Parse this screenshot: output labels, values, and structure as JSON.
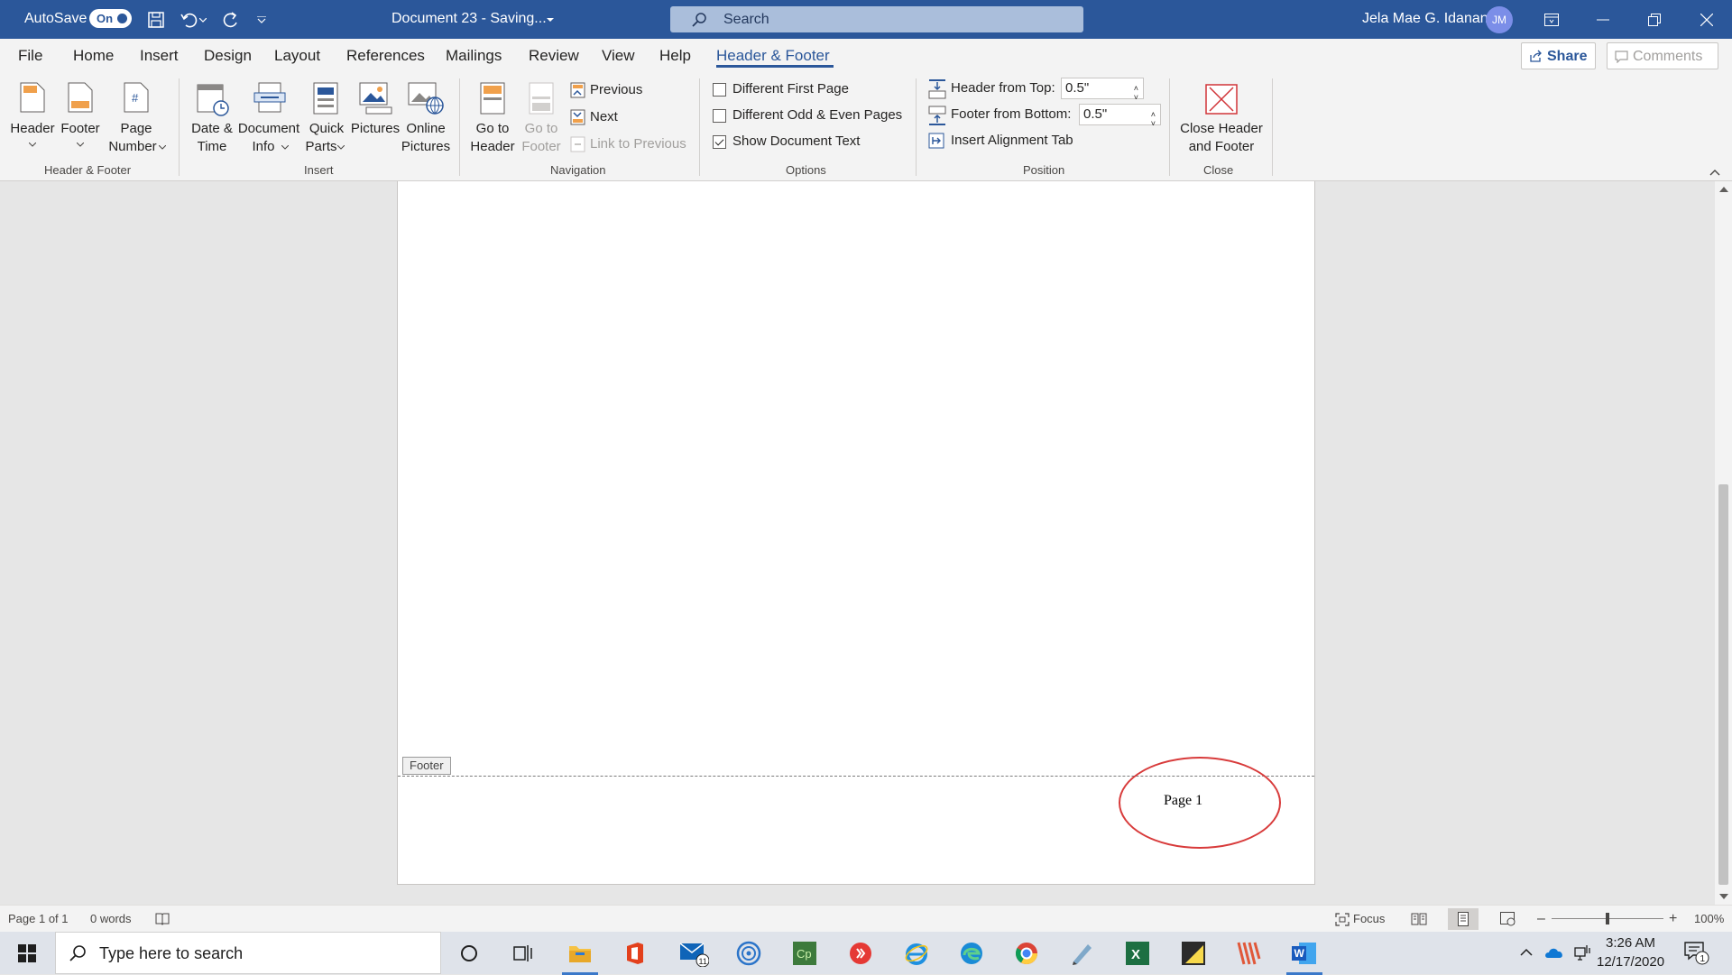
{
  "titlebar": {
    "autosave_label": "AutoSave",
    "autosave_state": "On",
    "document_title": "Document 23  -  Saving...",
    "search_placeholder": "Search",
    "user_name": "Jela Mae G. Idanan",
    "user_initials": "JM"
  },
  "tabs": [
    "File",
    "Home",
    "Insert",
    "Design",
    "Layout",
    "References",
    "Mailings",
    "Review",
    "View",
    "Help",
    "Header & Footer"
  ],
  "active_tab": "Header & Footer",
  "share_label": "Share",
  "comments_label": "Comments",
  "ribbon": {
    "groups": [
      "Header & Footer",
      "Insert",
      "Navigation",
      "Options",
      "Position",
      "Close"
    ],
    "header_footer": {
      "header": "Header",
      "footer": "Footer",
      "page_number_1": "Page",
      "page_number_2": "Number"
    },
    "insert": {
      "date_1": "Date &",
      "date_2": "Time",
      "docinfo_1": "Document",
      "docinfo_2": "Info",
      "quick_1": "Quick",
      "quick_2": "Parts",
      "pictures": "Pictures",
      "online_1": "Online",
      "online_2": "Pictures"
    },
    "navigation": {
      "goto_header_1": "Go to",
      "goto_header_2": "Header",
      "goto_footer_1": "Go to",
      "goto_footer_2": "Footer",
      "previous": "Previous",
      "next": "Next",
      "link_previous": "Link to Previous"
    },
    "options": {
      "different_first_page": "Different First Page",
      "different_first_page_checked": false,
      "odd_even": "Different Odd & Even Pages",
      "odd_even_checked": false,
      "show_doc_text": "Show Document Text",
      "show_doc_text_checked": true
    },
    "position": {
      "header_from_top_label": "Header from Top:",
      "header_from_top_value": "0.5\"",
      "footer_from_bottom_label": "Footer from Bottom:",
      "footer_from_bottom_value": "0.5\"",
      "alignment_tab": "Insert Alignment Tab"
    },
    "close": {
      "close_1": "Close Header",
      "close_2": "and Footer"
    }
  },
  "document": {
    "footer_tag": "Footer",
    "footer_text": "Page 1"
  },
  "statusbar": {
    "page": "Page 1 of 1",
    "words": "0 words",
    "focus": "Focus",
    "zoom": "100%"
  },
  "taskbar": {
    "search_placeholder": "Type here to search",
    "mail_badge": "11",
    "time": "3:26 AM",
    "date": "12/17/2020",
    "notification_count": "1"
  },
  "colors": {
    "word_blue": "#2b579a",
    "annotation_red": "#d83b3b",
    "ribbon_bg": "#f3f3f3"
  }
}
